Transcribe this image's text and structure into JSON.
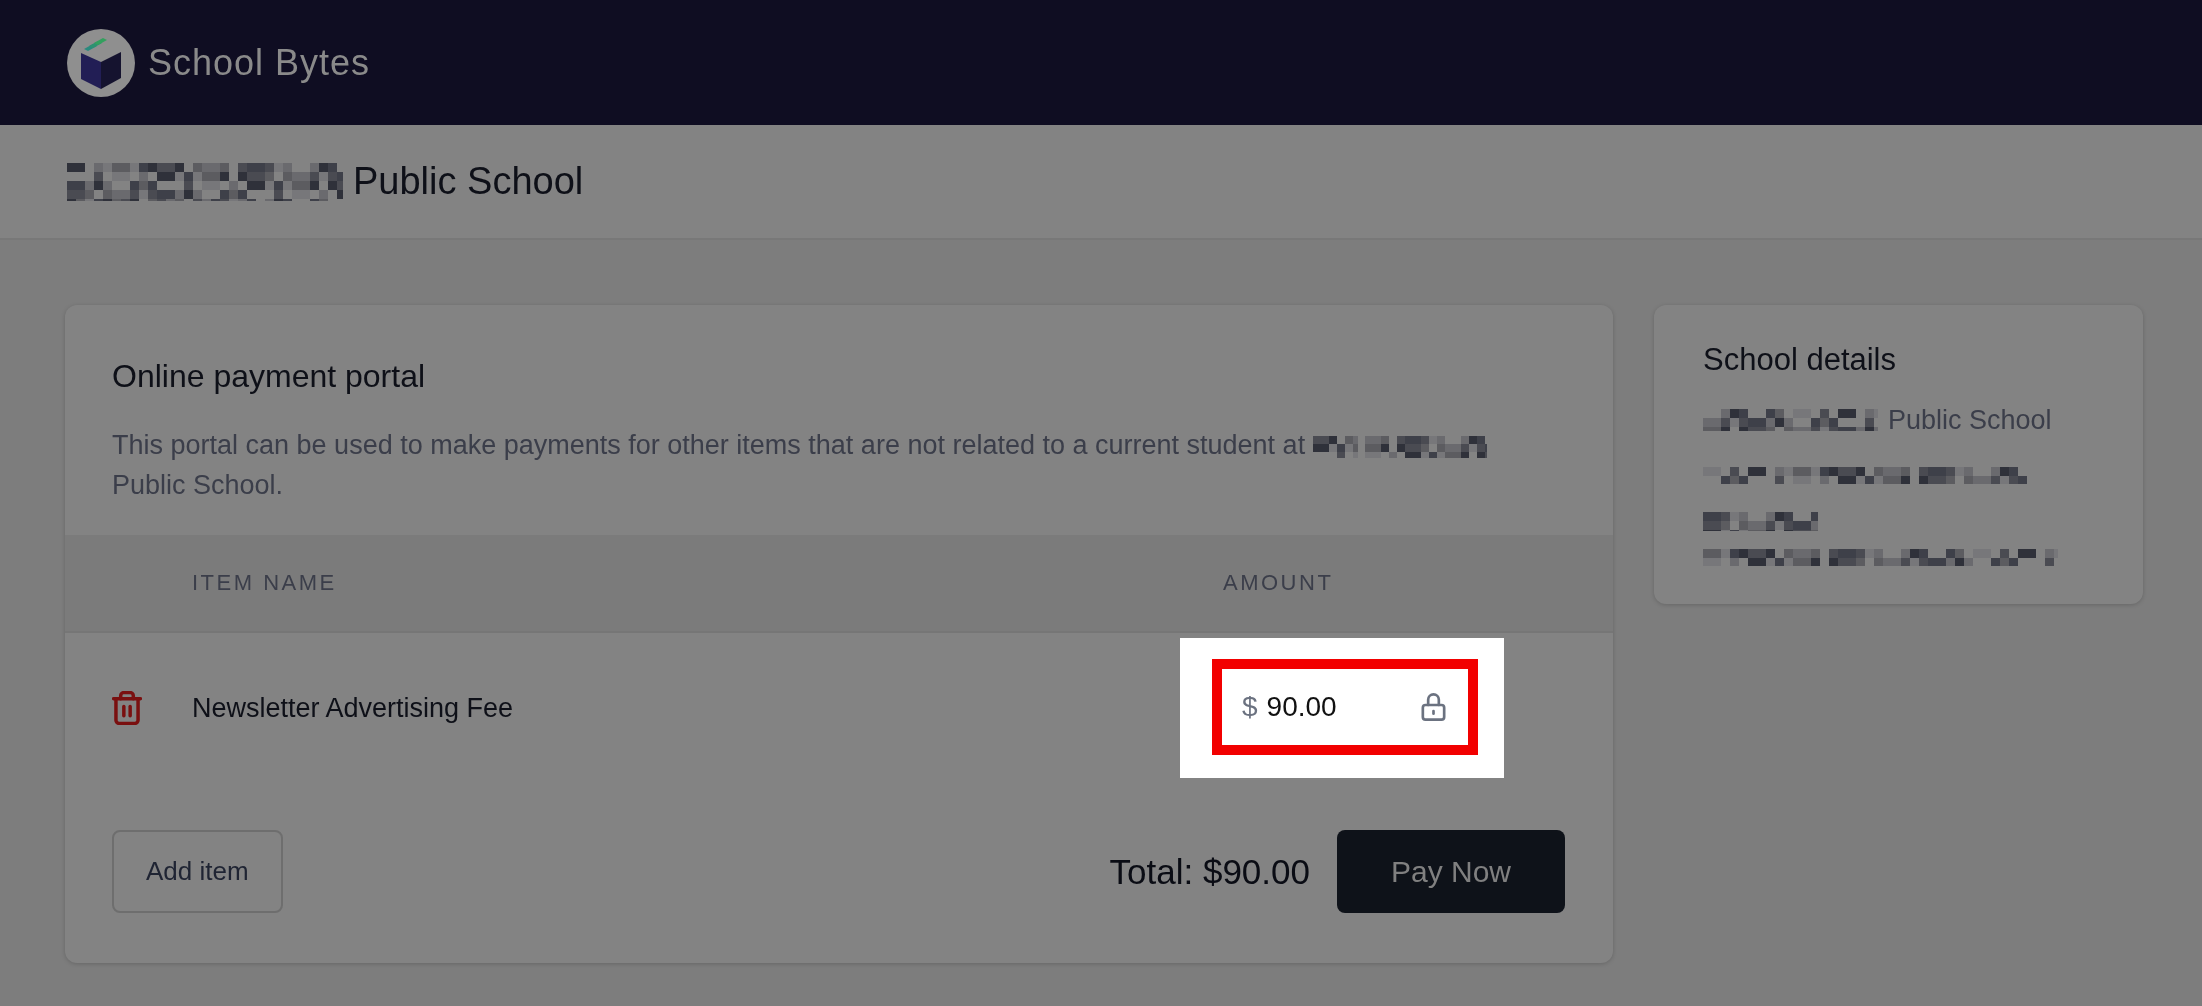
{
  "header": {
    "brand": "School Bytes"
  },
  "page_title": "Public School",
  "payment_portal": {
    "title": "Online payment portal",
    "description": "This portal can be used to make payments for other items that are not related to a current student at",
    "description_end": "Public School.",
    "table": {
      "columns": [
        "ITEM NAME",
        "AMOUNT"
      ],
      "rows": [
        {
          "item_name": "Newsletter Advertising Fee",
          "currency": "$",
          "amount": "90.00",
          "locked": true,
          "highlighted": true
        }
      ]
    },
    "add_button": "Add item",
    "total": "Total: $90.00",
    "pay_button": "Pay Now"
  },
  "school_details": {
    "title": "School details",
    "name": "Public School"
  }
}
